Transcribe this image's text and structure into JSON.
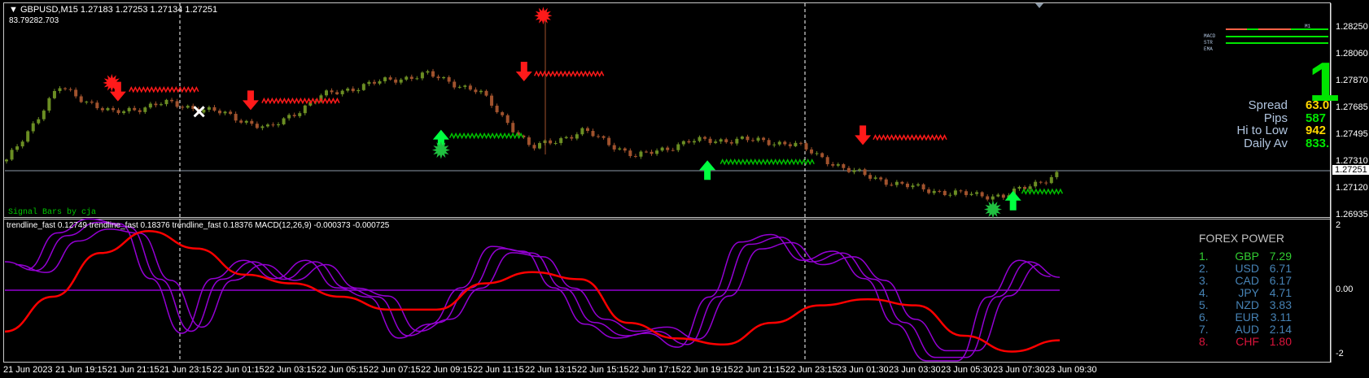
{
  "header": {
    "symbol_line": "GBPUSD,M15  1.27183 1.27253 1.27134 1.27251",
    "sub_line": "83.79282.703"
  },
  "signal_bars_label": "Signal Bars by cja",
  "indicator_legend": "trendline_fast 0.12749  trendline_fast 0.18376  trendline_fast 0.18376  MACD(12,26,9) -0.000373 -0.000725",
  "price_axis": {
    "labels": [
      "1.28250",
      "1.28060",
      "1.27870",
      "1.27685",
      "1.27495",
      "1.27310",
      "1.27120",
      "1.26935"
    ],
    "current_price": "1.27251"
  },
  "indicator_axis": {
    "labels": [
      "2",
      "0.00",
      "-2"
    ]
  },
  "time_axis": {
    "labels": [
      "21 Jun 2023",
      "21 Jun 19:15",
      "21 Jun 21:15",
      "21 Jun 23:15",
      "22 Jun 01:15",
      "22 Jun 03:15",
      "22 Jun 05:15",
      "22 Jun 07:15",
      "22 Jun 09:15",
      "22 Jun 11:15",
      "22 Jun 13:15",
      "22 Jun 15:15",
      "22 Jun 17:15",
      "22 Jun 19:15",
      "22 Jun 21:15",
      "22 Jun 23:15",
      "23 Jun 01:30",
      "23 Jun 03:30",
      "23 Jun 05:30",
      "23 Jun 07:30",
      "23 Jun 09:30"
    ]
  },
  "trend_panel": {
    "labels": [
      "MACD",
      "STR",
      "EMA"
    ],
    "timeframe": "M1",
    "big_signal": "1"
  },
  "info": [
    {
      "label": "Spread",
      "value": "63.0",
      "color": "#ffd700"
    },
    {
      "label": "Pips",
      "value": "587",
      "color": "#00e600"
    },
    {
      "label": "Hi to Low",
      "value": "942",
      "color": "#ffd700"
    },
    {
      "label": "Daily Av",
      "value": "833.",
      "color": "#00e600"
    }
  ],
  "forex_power": {
    "title": "FOREX POWER",
    "rows": [
      {
        "rank": "1.",
        "ccy": "GBP",
        "val": "7.29",
        "color": "#32cd32"
      },
      {
        "rank": "2.",
        "ccy": "USD",
        "val": "6.71",
        "color": "#4682b4"
      },
      {
        "rank": "3.",
        "ccy": "CAD",
        "val": "6.17",
        "color": "#4682b4"
      },
      {
        "rank": "4.",
        "ccy": "JPY",
        "val": "4.71",
        "color": "#4682b4"
      },
      {
        "rank": "5.",
        "ccy": "NZD",
        "val": "3.83",
        "color": "#4682b4"
      },
      {
        "rank": "6.",
        "ccy": "EUR",
        "val": "3.11",
        "color": "#4682b4"
      },
      {
        "rank": "7.",
        "ccy": "AUD",
        "val": "2.14",
        "color": "#4682b4"
      },
      {
        "rank": "8.",
        "ccy": "CHF",
        "val": "1.80",
        "color": "#dc143c"
      }
    ]
  },
  "colors": {
    "bull": "#6b8e23",
    "bear": "#a0522d",
    "macd": "#ff0000",
    "osc": "#9400d3",
    "up": "#00ff40",
    "down": "#ff1a1a"
  },
  "price_path": [
    1.27314,
    1.27834,
    1.27649,
    1.27723,
    1.27662,
    1.2754,
    1.27772,
    1.27863,
    1.27924,
    1.27802,
    1.27405,
    1.27527,
    1.27345,
    1.27454,
    1.27466,
    1.27436,
    1.27254,
    1.27149,
    1.27089,
    1.27069,
    1.27222
  ],
  "macd_values": [
    -1.28,
    -0.2,
    1.15,
    1.83,
    1.29,
    0.48,
    0.21,
    -0.2,
    -0.6,
    -0.6,
    0.21,
    0.56,
    0.34,
    -1.01,
    -1.49,
    -1.68,
    -1.01,
    -0.47,
    -0.28,
    -0.47,
    -1.41,
    -1.9,
    -1.55
  ],
  "osc_values": [
    0.88,
    0.61,
    1.69,
    2.1,
    1.96,
    0.34,
    -1.27,
    0.34,
    0.88,
    0.34,
    0.88,
    0.07,
    -0.2,
    -1.41,
    -1.0,
    0.07,
    1.29,
    1.15,
    0.07,
    -1.0,
    -1.41,
    -1.27,
    -1.68,
    -0.2,
    1.42,
    1.64,
    0.88,
    1.15,
    0.34,
    -1.0,
    -2.08,
    -2.08,
    -0.2,
    0.88,
    0.4
  ]
}
